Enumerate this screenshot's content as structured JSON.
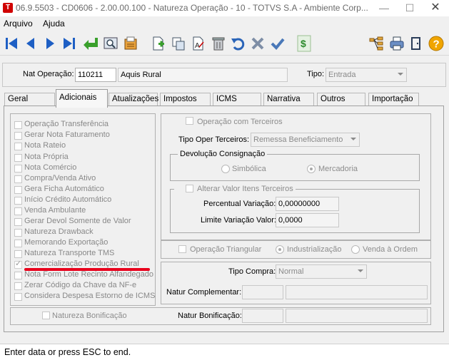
{
  "window": {
    "title": "06.9.5503 - CD0606 - 2.00.00.100 - Natureza Operação - 10 - TOTVS S.A - Ambiente Corp...",
    "app_icon": "T"
  },
  "menu": [
    "Arquivo",
    "Ajuda"
  ],
  "toolbar": {
    "dollar_glyph": "$",
    "help_glyph": "?",
    "icons": [
      "first-record-icon",
      "previous-record-icon",
      "next-record-icon",
      "last-record-icon",
      "return-icon",
      "search-icon",
      "report-icon",
      "new-record-icon",
      "copy-record-icon",
      "edit-record-icon",
      "delete-record-icon",
      "undo-icon",
      "cancel-icon",
      "confirm-icon",
      "dollar-icon",
      "tree-icon",
      "print-icon",
      "exit-icon",
      "help-icon"
    ]
  },
  "header": {
    "nat_operacao_label": "Nat Operação:",
    "nat_operacao_code": "110211",
    "nat_operacao_desc": "Aquis Rural",
    "tipo_label": "Tipo:",
    "tipo_value": "Entrada"
  },
  "tabs": [
    "Geral",
    "Adicionais",
    "Atualizações",
    "Impostos",
    "ICMS",
    "Narrativa",
    "Outros",
    "Importação"
  ],
  "active_tab": "Adicionais",
  "left_checkboxes": [
    "Operação Transferência",
    "Gerar Nota Faturamento",
    "Nota Rateio",
    "Nota Própria",
    "Nota Comércio",
    "Compra/Venda Ativo",
    "Gera Ficha Automático",
    "Início Crédito Automático",
    "Venda Ambulante",
    "Gerar Devol Somente de Valor",
    "Natureza Drawback",
    "Memorando Exportação",
    "Natureza Transporte TMS",
    "Comercialização Produção Rural",
    "Nota Form Lote Recinto Alfandegado",
    "Zerar Código da Chave da NF-e",
    "Considera Despesa Estorno de ICMS"
  ],
  "checked_item": "Comercialização Produção Rural",
  "highlight_color": "#e8001c",
  "terceiros": {
    "op_com_terceiros_label": "Operação com Terceiros",
    "tipo_oper_label": "Tipo Oper Terceiros:",
    "tipo_oper_value": "Remessa Beneficiamento",
    "devolucao_title": "Devolução Consignação",
    "radio_simbolica": "Simbólica",
    "radio_mercadoria": "Mercadoria",
    "alterar_valor_label": "Alterar Valor Itens Terceiros",
    "percentual_label": "Percentual Variação:",
    "percentual_value": "0,00000000",
    "limite_label": "Limite Variação Valor:",
    "limite_value": "0,0000"
  },
  "triangular": {
    "op_triangular_label": "Operação Triangular",
    "radio_industrializacao": "Industrialização",
    "radio_venda_ordem": "Venda à Ordem"
  },
  "compra": {
    "tipo_compra_label": "Tipo Compra:",
    "tipo_compra_value": "Normal",
    "natur_complementar_label": "Natur Complementar:"
  },
  "bonificacao": {
    "natureza_bonificacao_label": "Natureza Bonificação",
    "natur_bonificacao_label": "Natur Bonificação:"
  },
  "status": "Enter data or press ESC to end."
}
